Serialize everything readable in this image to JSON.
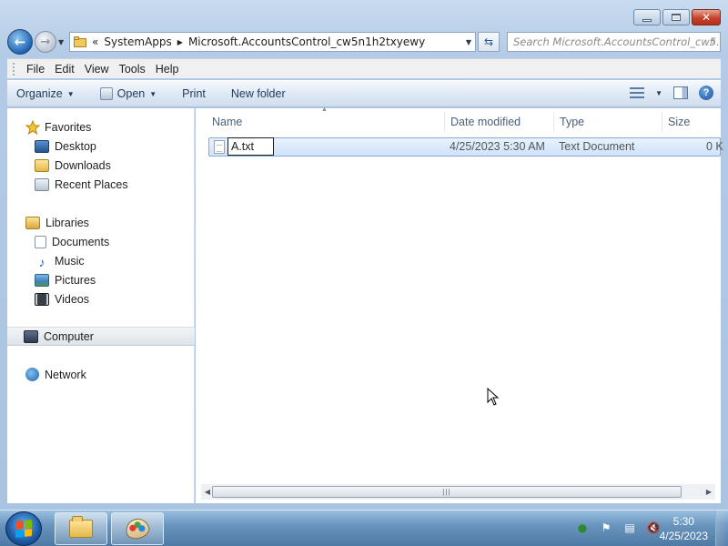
{
  "window": {
    "caption": {
      "minimize_icon": "minimize-icon",
      "maximize_icon": "maximize-icon",
      "close_icon": "close-icon"
    }
  },
  "address_bar": {
    "overflow": "«",
    "crumbs": [
      "SystemApps",
      "Microsoft.AccountsControl_cw5n1h2txyewy"
    ]
  },
  "search": {
    "placeholder": "Search Microsoft.AccountsControl_cw5..."
  },
  "menu": {
    "items": [
      "File",
      "Edit",
      "View",
      "Tools",
      "Help"
    ]
  },
  "toolbar": {
    "organize": "Organize",
    "open": "Open",
    "print": "Print",
    "new_folder": "New folder"
  },
  "nav_pane": {
    "favorites": "Favorites",
    "desktop": "Desktop",
    "downloads": "Downloads",
    "recent_places": "Recent Places",
    "libraries": "Libraries",
    "documents": "Documents",
    "music": "Music",
    "pictures": "Pictures",
    "videos": "Videos",
    "computer": "Computer",
    "network": "Network"
  },
  "columns": {
    "name": "Name",
    "date_modified": "Date modified",
    "type": "Type",
    "size": "Size"
  },
  "file": {
    "rename_value": "A.txt",
    "date_modified": "4/25/2023 5:30 AM",
    "type": "Text Document",
    "size": "0 K"
  },
  "taskbar": {
    "time": "5:30",
    "date": "4/25/2023"
  },
  "colors": {
    "selection": "#cfe3fa",
    "accent": "#1f63b2"
  }
}
